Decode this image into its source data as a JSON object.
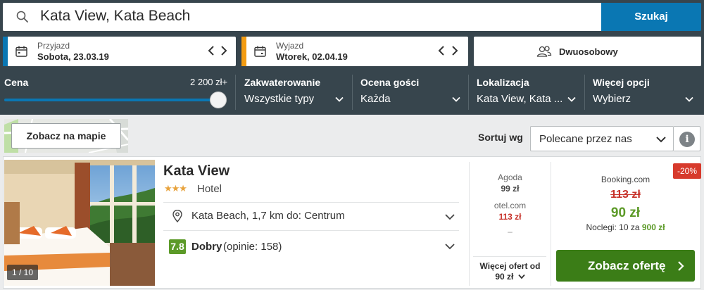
{
  "search": {
    "value": "Kata View, Kata Beach",
    "button": "Szukaj"
  },
  "checkin": {
    "label": "Przyjazd",
    "value": "Sobota, 23.03.19",
    "accent": "#0a77b3"
  },
  "checkout": {
    "label": "Wyjazd",
    "value": "Wtorek, 02.04.19",
    "accent": "#f39c12"
  },
  "room": {
    "value": "Dwuosobowy"
  },
  "filters": {
    "price": {
      "label": "Cena",
      "max": "2 200 zł+",
      "level": 1.0
    },
    "accommodation": {
      "label": "Zakwaterowanie",
      "value": "Wszystkie typy"
    },
    "rating": {
      "label": "Ocena gości",
      "value": "Każda"
    },
    "location": {
      "label": "Lokalizacja",
      "value": "Kata View, Kata ..."
    },
    "more": {
      "label": "Więcej opcji",
      "value": "Wybierz"
    }
  },
  "map": {
    "button": "Zobacz na mapie"
  },
  "sort": {
    "label": "Sortuj wg",
    "value": "Polecane przez nas"
  },
  "hotel": {
    "name": "Kata View",
    "stars": 3,
    "stars_text": "★★★",
    "type": "Hotel",
    "photo_counter": "1 / 10",
    "location": "Kata Beach, 1,7 km do: Centrum",
    "rating_score": "7.8",
    "rating_word": "Dobry",
    "rating_count": "(opinie: 158)"
  },
  "other_offers": [
    {
      "name": "Agoda",
      "price": "99 zł"
    },
    {
      "name": "otel.com",
      "price": "113 zł"
    }
  ],
  "other_dash": "–",
  "more_offers": {
    "line1": "Więcej ofert od",
    "line2": "90 zł"
  },
  "best_offer": {
    "discount": "-20%",
    "provider": "Booking.com",
    "old_price": "113 zł",
    "price": "90 zł",
    "nights_text": "Noclegi: 10 za",
    "nights_total": "900 zł",
    "cta": "Zobacz ofertę"
  },
  "colors": {
    "header": "#37454d",
    "primary": "#0a77b3",
    "green": "#3b7d17",
    "red": "#d73a2c"
  }
}
